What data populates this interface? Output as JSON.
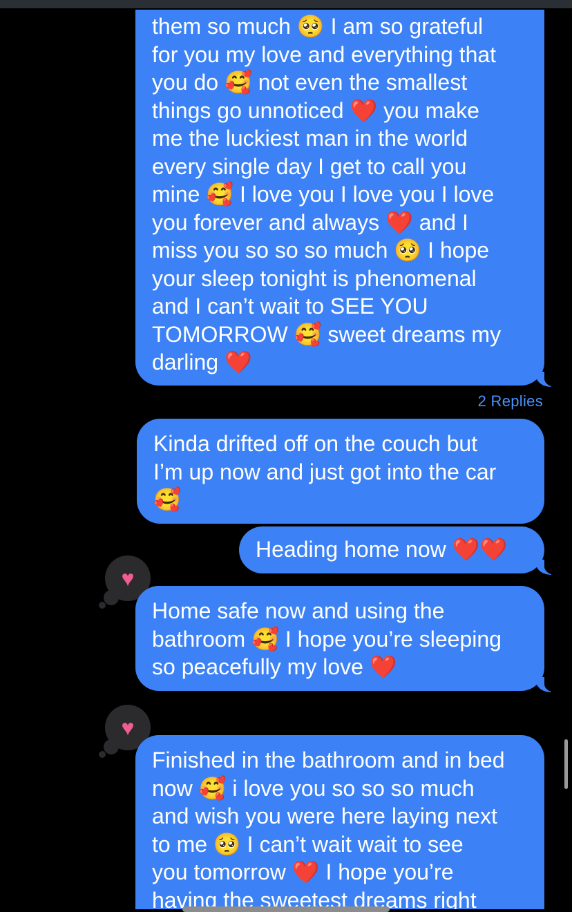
{
  "messages": [
    {
      "id": "msg-1",
      "lines": [
        "them so much 🥺 I am so grateful",
        "for you my love and everything that",
        "you do 🥰 not even the smallest",
        "things go unnoticed ❤️ you make",
        "me the luckiest man in the world",
        "every single day I get to call you",
        "mine 🥰 I love you I love you I love",
        "you forever and always ❤️ and I",
        "miss you so so so much 🥺 I hope",
        "your sleep tonight is phenomenal",
        "and I can’t wait to SEE YOU",
        "TOMORROW 🥰 sweet dreams my",
        "darling ❤️"
      ]
    },
    {
      "id": "msg-2",
      "lines": [
        "Kinda drifted off on the couch but",
        "I’m up now and just got into the car",
        "🥰"
      ]
    },
    {
      "id": "msg-3",
      "lines": [
        "Heading home now ❤️❤️"
      ]
    },
    {
      "id": "msg-4",
      "lines": [
        "Home safe now and using the",
        "bathroom 🥰 I hope you’re sleeping",
        "so peacefully my love ❤️"
      ]
    },
    {
      "id": "msg-5",
      "lines": [
        "Finished in the bathroom and in bed",
        "now 🥰 i love you so so so much",
        "and wish you were here laying next",
        "to me 🥺 I can’t wait wait to see",
        "you tomorrow ❤️ I hope you’re",
        "having the sweetest dreams right"
      ]
    }
  ],
  "thread": {
    "replies_label": "2 Replies"
  },
  "reactions": {
    "icon": "heart-icon",
    "glyph": "♥"
  },
  "colors": {
    "background": "#000000",
    "bubble": "#3c82f6",
    "replies_link": "#4a93ff",
    "reaction_bubble": "#2b2b2d",
    "reaction_heart": "#f05d8f"
  }
}
